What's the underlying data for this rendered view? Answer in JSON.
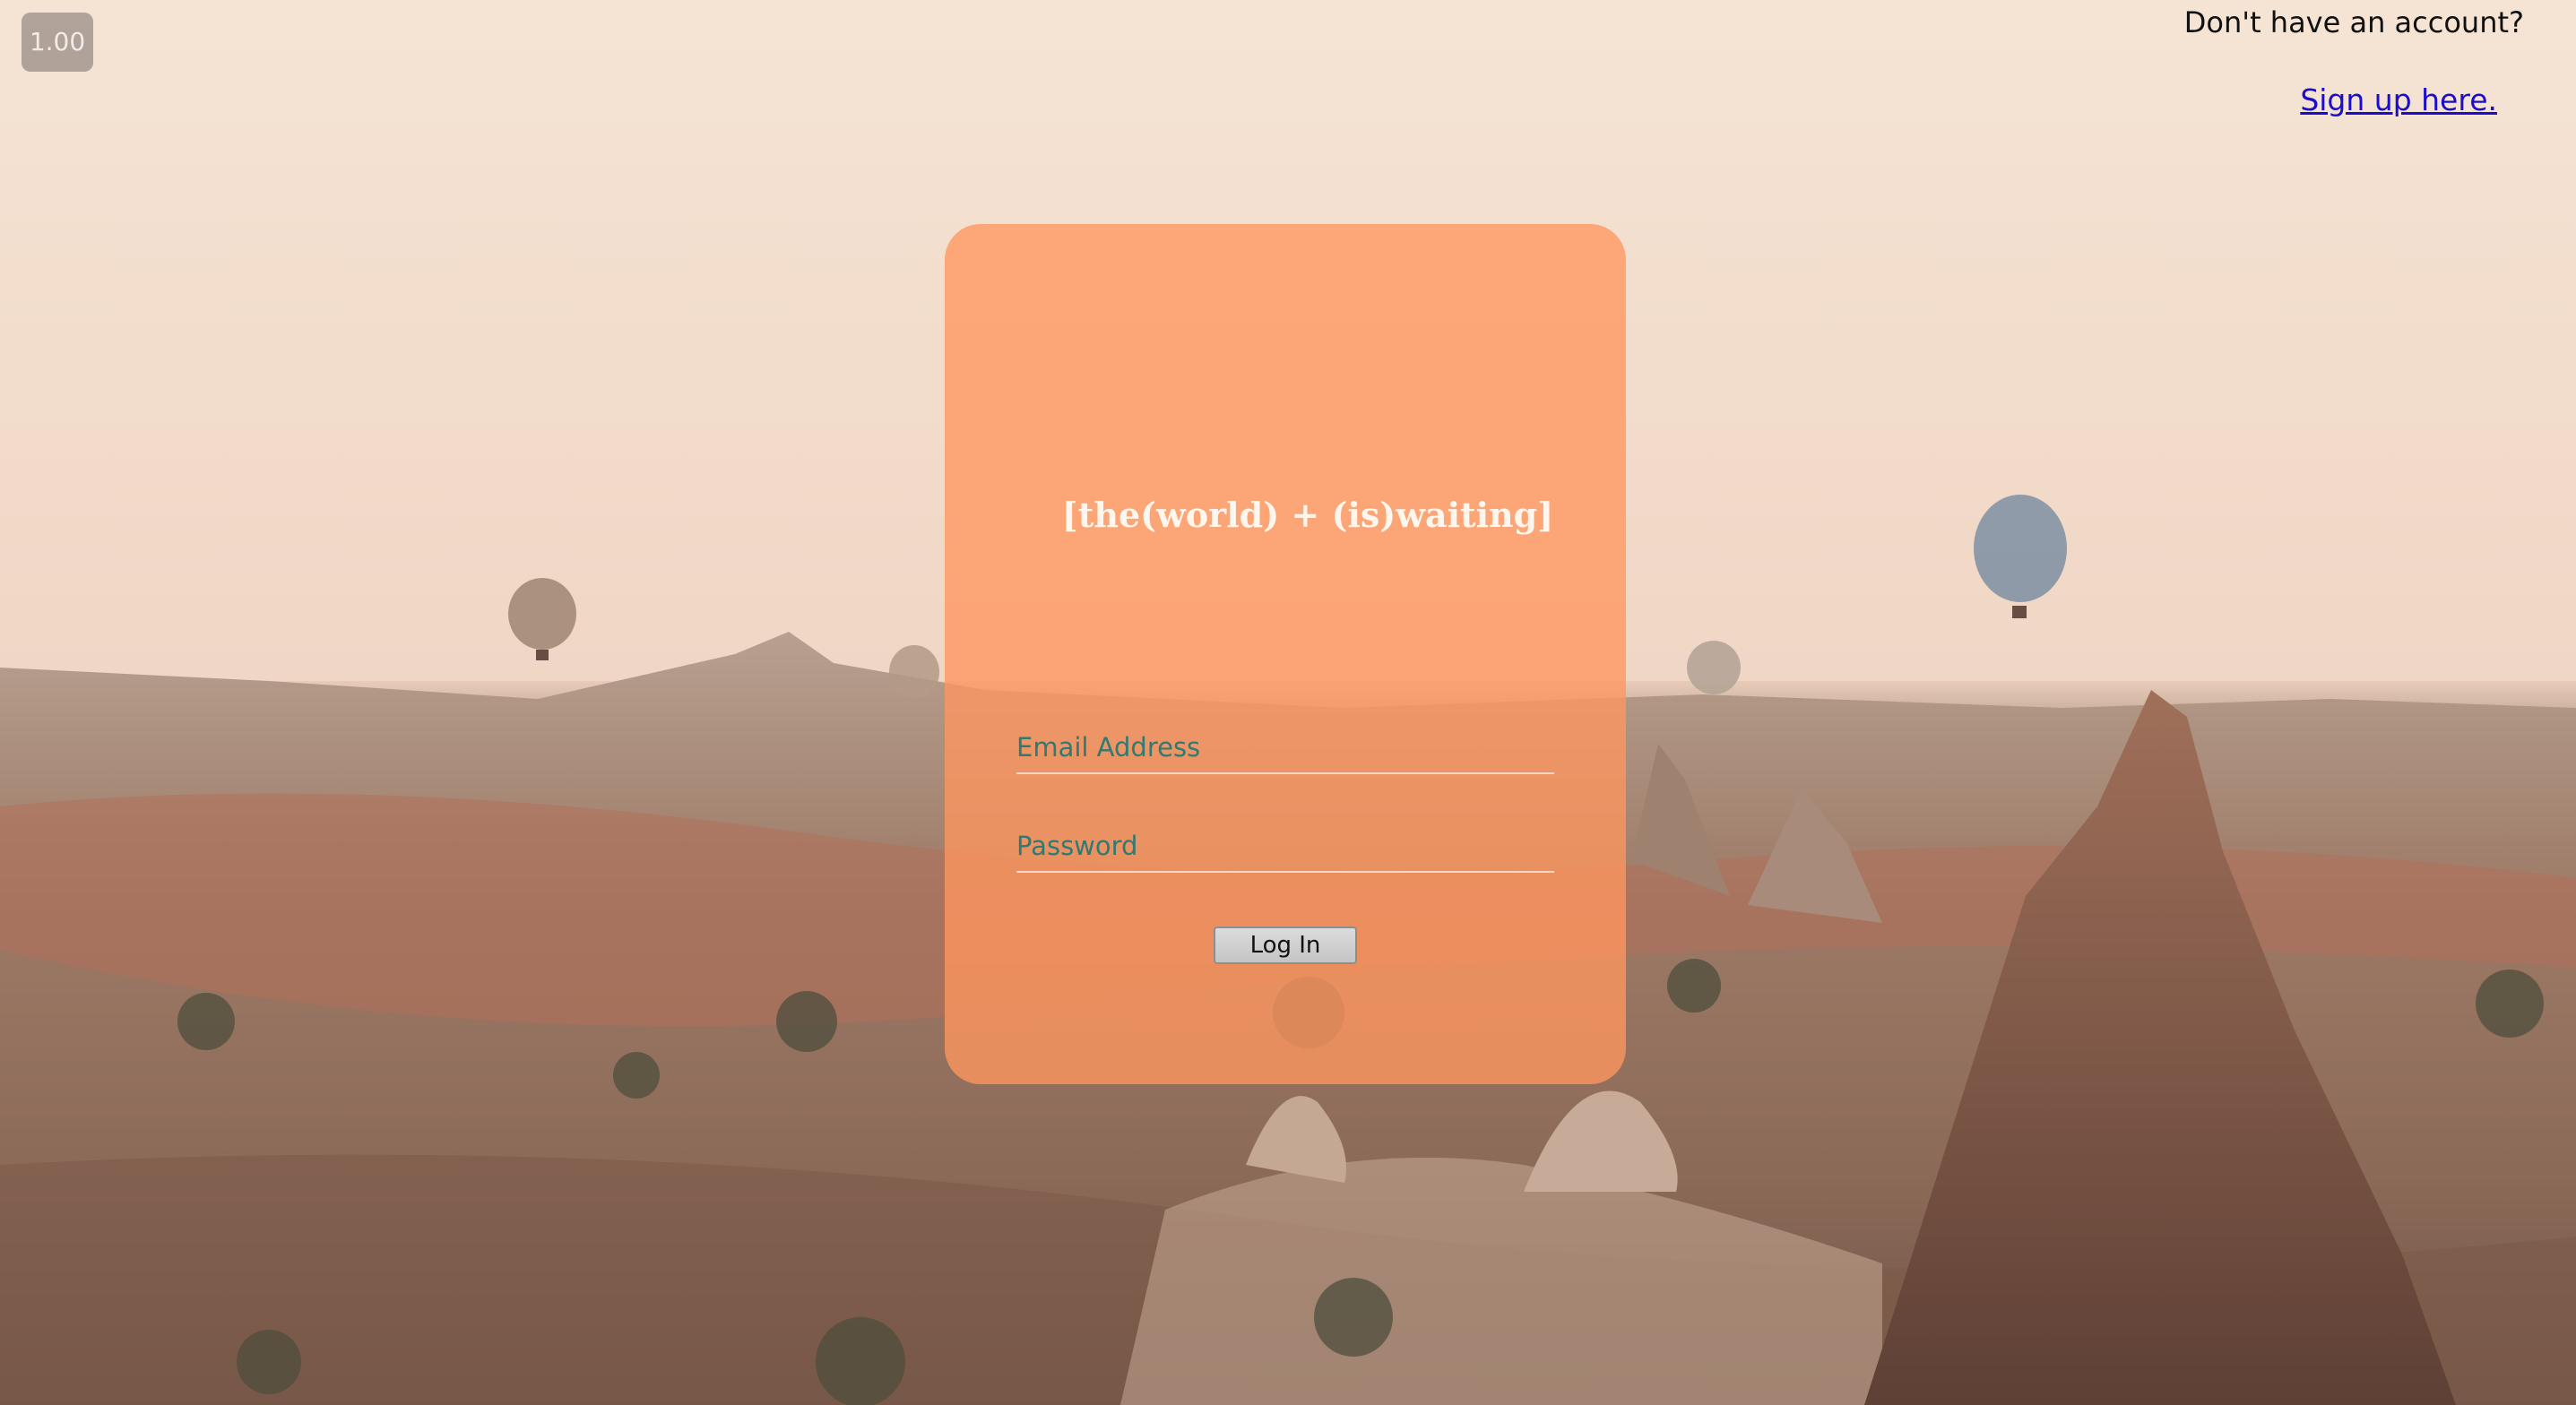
{
  "zoom_level": "1.00",
  "header": {
    "signup_prompt": "Don't have an account?",
    "signup_link": "Sign up here."
  },
  "login_card": {
    "title": "[the(world) + (is)waiting]",
    "email_placeholder": "Email Address",
    "password_placeholder": "Password",
    "login_button": "Log In"
  },
  "colors": {
    "card_background": "#ffa068",
    "field_text": "#2f7a72",
    "link": "#1a0dcc",
    "title": "#fff6ee"
  },
  "background_image": "cappadocia-hot-air-balloons-landscape"
}
